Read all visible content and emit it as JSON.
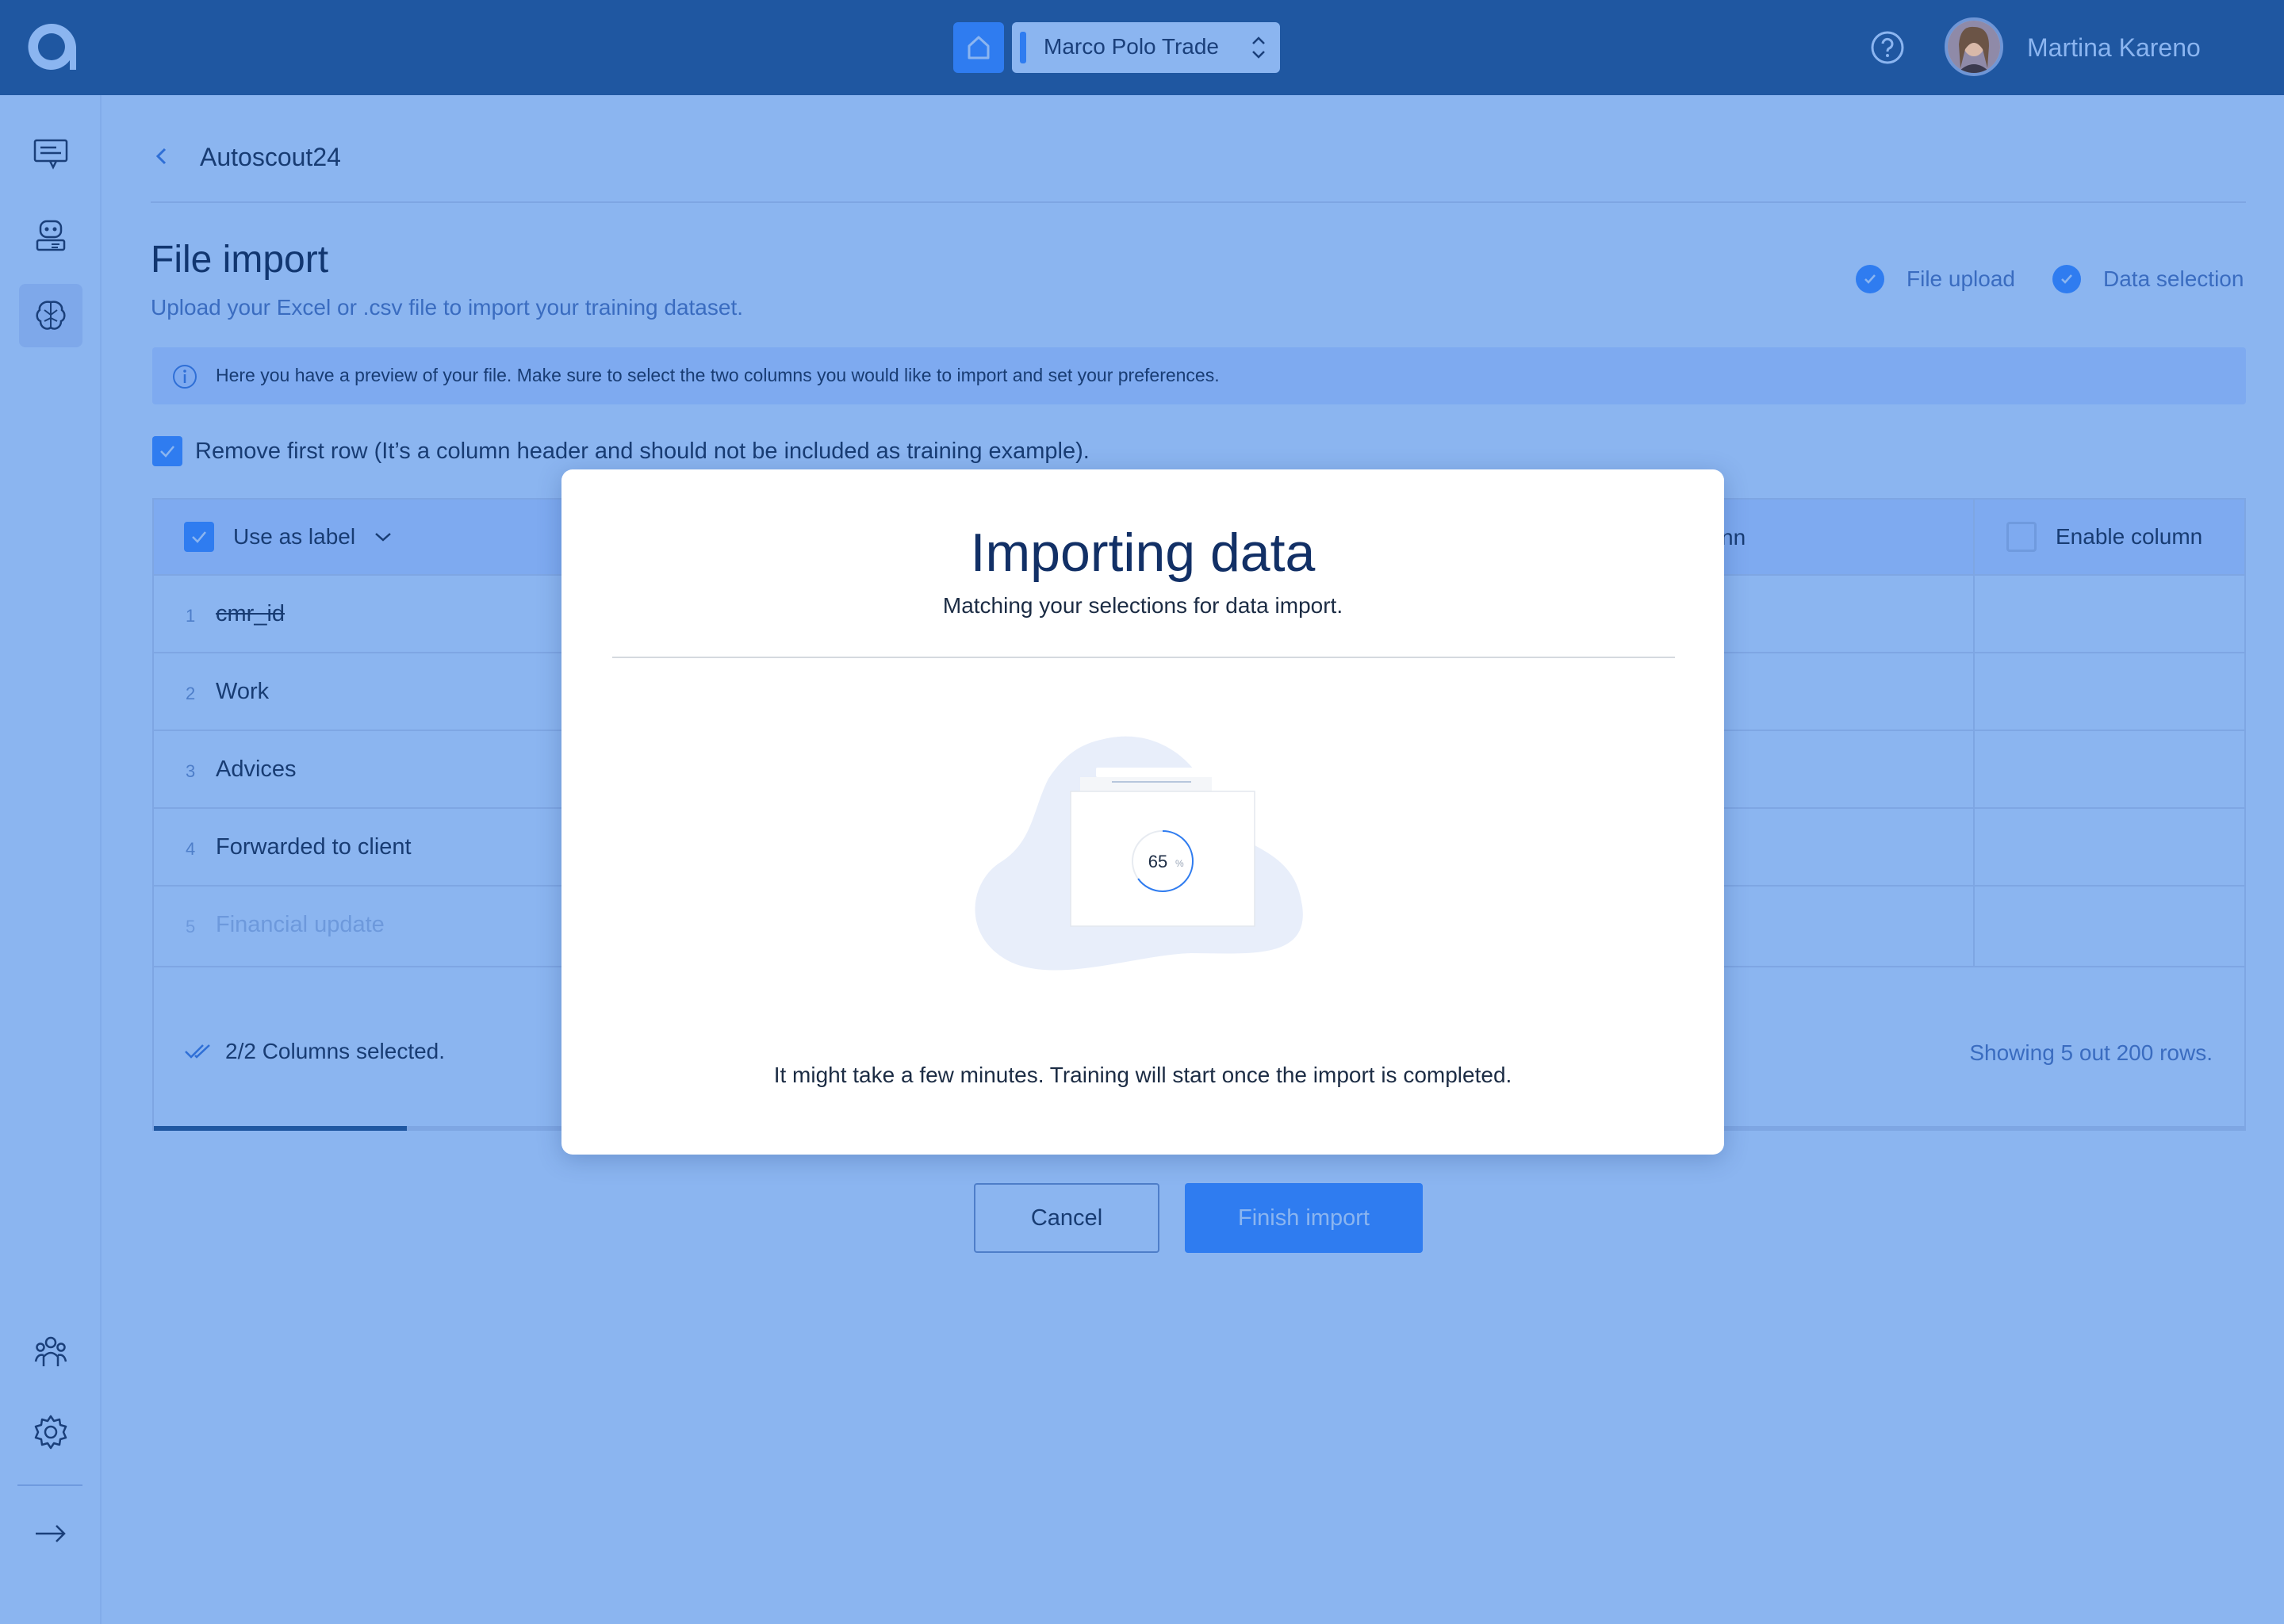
{
  "colors": {
    "topbar": "#1f57a1",
    "overlay_background": "#8bb5f0",
    "accent": "#2f7cf0",
    "modal_background": "#ffffff",
    "modal_title": "#123066"
  },
  "topbar": {
    "logo_icon": "brand-a-logo",
    "home_icon": "home-icon",
    "workspace": "Marco Polo Trade",
    "help_icon": "question-circle-icon",
    "user_name": "Martina Kareno"
  },
  "sidebar": {
    "items": [
      {
        "icon": "chat-icon"
      },
      {
        "icon": "bot-icon"
      },
      {
        "icon": "brain-icon",
        "active": true
      },
      {
        "icon": "team-icon"
      },
      {
        "icon": "gear-icon"
      },
      {
        "icon": "arrow-right-icon"
      }
    ]
  },
  "breadcrumb": {
    "label": "Autoscout24"
  },
  "page": {
    "title": "File import",
    "subtitle": "Upload your Excel or .csv file to import your training dataset.",
    "steps": [
      {
        "label": "File upload",
        "done": true
      },
      {
        "label": "Data selection",
        "done": true
      }
    ],
    "info_text": "Here you have a preview of your file. Make sure to select the two columns you would like to import and set your preferences.",
    "remove_first_row_label": "Remove first row (It’s a column header and should not be included as training example).",
    "remove_first_row_checked": true
  },
  "table": {
    "label_header": "Use as label",
    "partial_header": "nn",
    "enable_header": "Enable column",
    "rows": [
      {
        "num": "1",
        "value": "cmr_id",
        "struck": true
      },
      {
        "num": "2",
        "value": "Work"
      },
      {
        "num": "3",
        "value": "Advices"
      },
      {
        "num": "4",
        "value": "Forwarded to client"
      },
      {
        "num": "5",
        "value": "Financial update",
        "faded": true
      }
    ],
    "selected_text": "2/2 Columns selected.",
    "showing_text": "Showing 5 out 200 rows.",
    "scroll_progress": 0.121
  },
  "actions": {
    "cancel": "Cancel",
    "finish": "Finish import"
  },
  "modal": {
    "title": "Importing data",
    "subtitle": "Matching your selections for data import.",
    "progress_value": "65",
    "progress_unit": "%",
    "progress": 0.65,
    "note": "It might take a few minutes. Training will start once the import is completed."
  }
}
